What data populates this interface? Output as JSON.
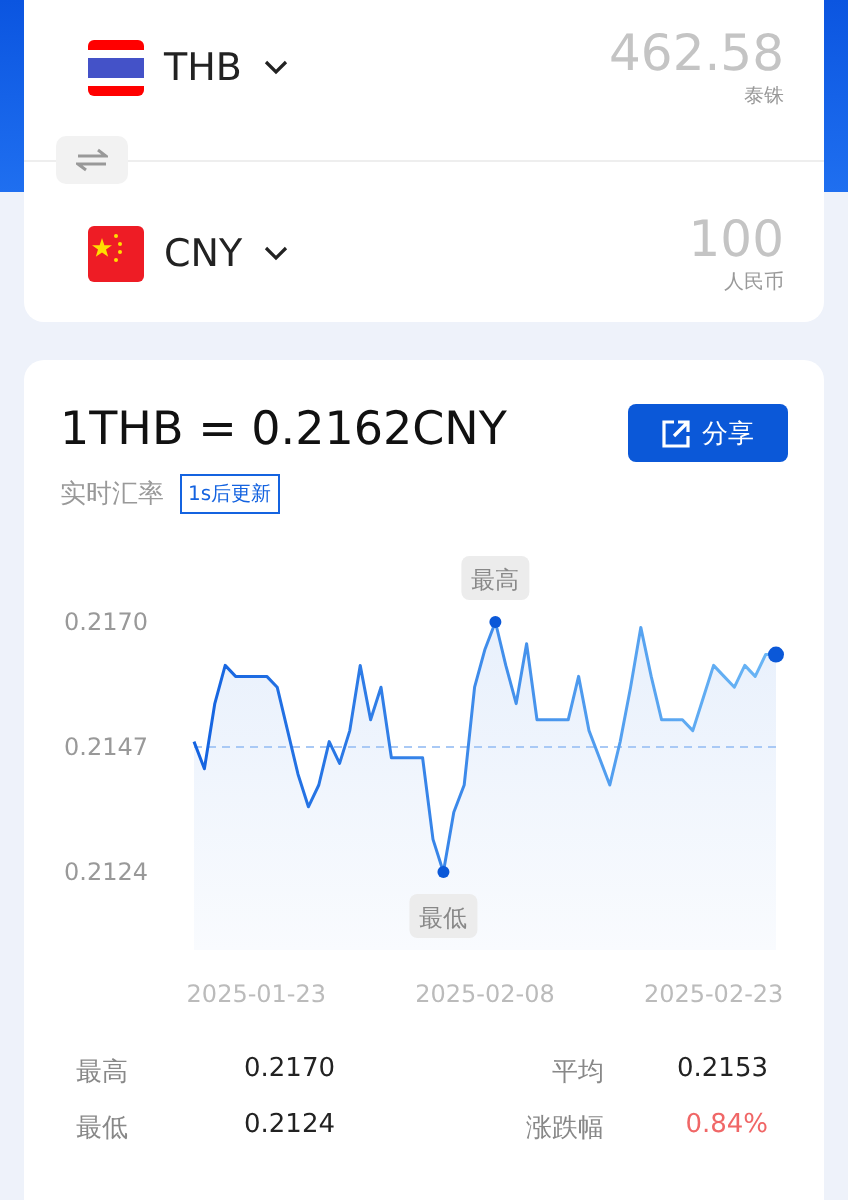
{
  "converter": {
    "rows": [
      {
        "kind": "th",
        "code": "THB",
        "amount": "462.58",
        "currency_name": "泰铢"
      },
      {
        "kind": "cn",
        "code": "CNY",
        "amount": "100",
        "currency_name": "人民币"
      }
    ]
  },
  "rate": {
    "title": "1THB = 0.2162CNY",
    "subtitle": "实时汇率",
    "badge": "1s后更新",
    "share_button": "分享"
  },
  "chart_data": {
    "type": "area",
    "categories": [
      null,
      null,
      null,
      null,
      null,
      null,
      "2025-01-23",
      null,
      null,
      null,
      null,
      null,
      null,
      null,
      null,
      null,
      null,
      null,
      null,
      null,
      null,
      null,
      null,
      null,
      null,
      null,
      null,
      null,
      "2025-02-08",
      null,
      null,
      null,
      null,
      null,
      null,
      null,
      null,
      null,
      null,
      null,
      null,
      null,
      null,
      null,
      null,
      null,
      null,
      null,
      null,
      null,
      "2025-02-23",
      null,
      null,
      null,
      null,
      null,
      null
    ],
    "series": [
      {
        "color": "#1463e0",
        "values": [
          0.2148,
          0.2143,
          0.2155,
          0.2162,
          0.216,
          0.216,
          0.216,
          0.216,
          0.2158,
          0.215,
          0.2142,
          0.2136,
          0.214,
          0.2148,
          0.2144,
          0.215,
          0.2162,
          0.2152,
          0.2158,
          0.2145,
          0.2145,
          0.2145,
          0.2145,
          0.213,
          0.2124,
          0.2135,
          0.214,
          0.2158,
          0.2165,
          0.217,
          0.2162,
          0.2155,
          0.2166,
          0.2152,
          0.2152,
          0.2152,
          0.2152,
          0.216,
          0.215,
          0.2145,
          0.214,
          0.2148,
          0.2158,
          0.2169,
          0.216,
          0.2152,
          0.2152,
          0.2152,
          0.215,
          0.2156,
          0.2162,
          0.216,
          0.2158,
          0.2162,
          0.216,
          0.2164,
          0.2164
        ]
      }
    ],
    "yticks": [
      {
        "value": 0.2124,
        "label": "0.2124"
      },
      {
        "value": 0.2147,
        "label": "0.2147"
      },
      {
        "value": 0.217,
        "label": "0.2170"
      }
    ],
    "ylim": [
      0.2124,
      0.217
    ],
    "ref_lines": [
      {
        "axis": "y",
        "value": 0.2147
      }
    ],
    "annotations": [
      {
        "y": 0.217,
        "text": "最高"
      },
      {
        "y": 0.2124,
        "text": "最低"
      }
    ]
  },
  "stats": [
    {
      "label": "最高",
      "value": "0.2170",
      "kind": "plain"
    },
    {
      "label": "平均",
      "value": "0.2153",
      "kind": "plain"
    },
    {
      "label": "最低",
      "value": "0.2124",
      "kind": "plain"
    },
    {
      "label": "涨跌幅",
      "value": "0.84%",
      "kind": "change"
    }
  ]
}
